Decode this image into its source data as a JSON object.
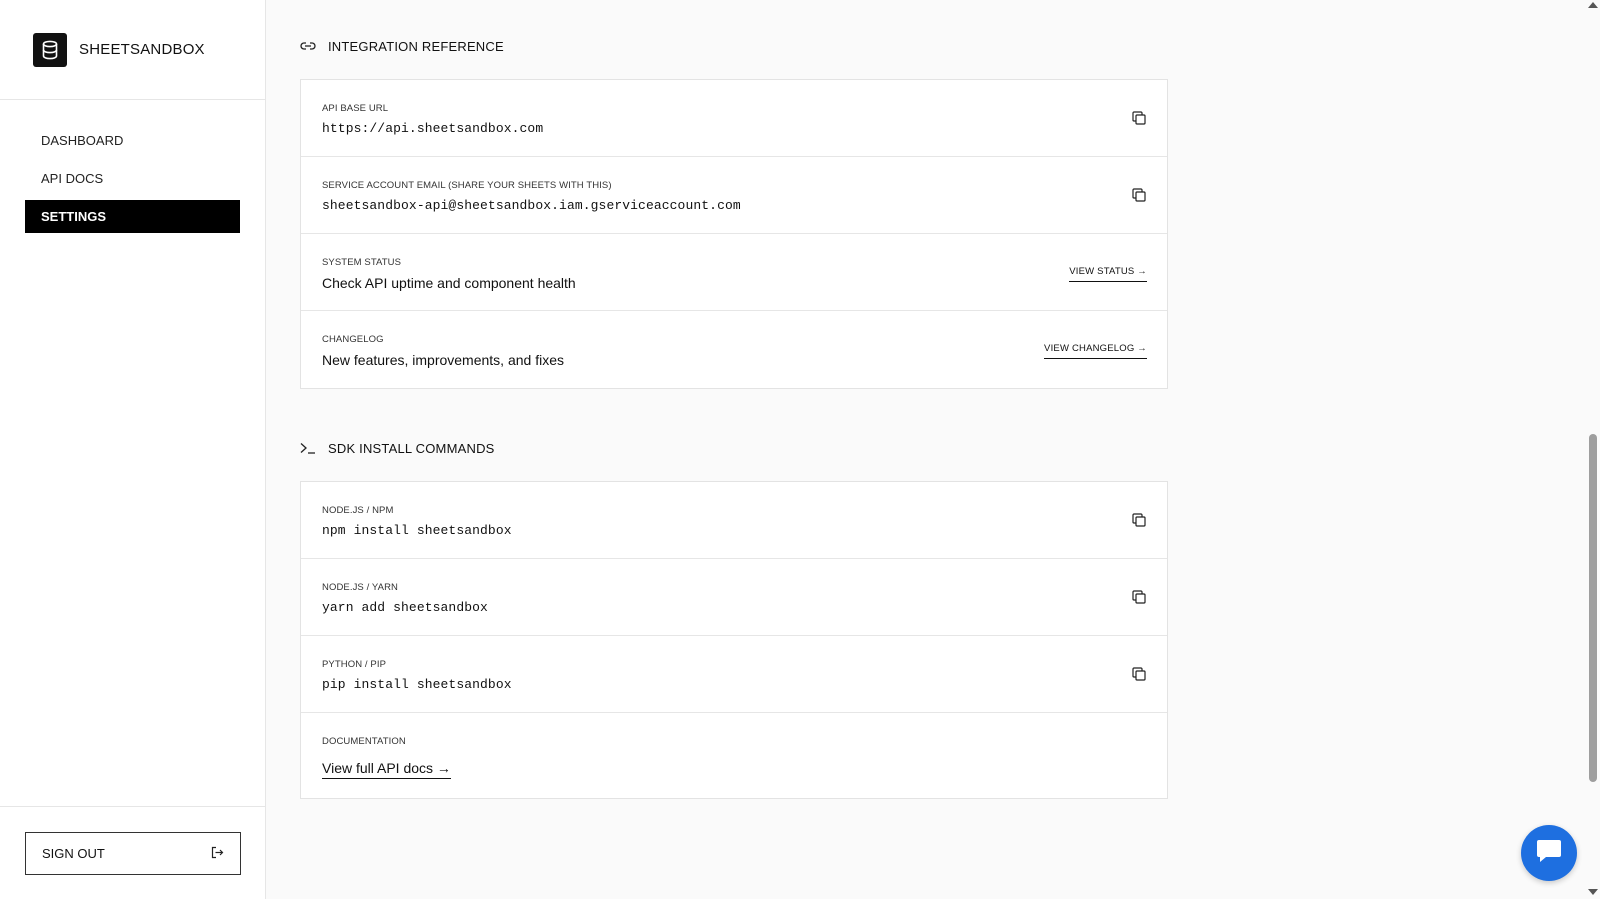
{
  "brand": {
    "name": "SHEETSANDBOX"
  },
  "nav": {
    "items": [
      {
        "label": "DASHBOARD"
      },
      {
        "label": "API DOCS"
      },
      {
        "label": "SETTINGS"
      }
    ]
  },
  "sidebar_bottom": {
    "signout_label": "SIGN OUT"
  },
  "integration": {
    "title": "INTEGRATION REFERENCE",
    "rows": [
      {
        "label": "API BASE URL",
        "value": "https://api.sheetsandbox.com"
      },
      {
        "label": "SERVICE ACCOUNT EMAIL (SHARE YOUR SHEETS WITH THIS)",
        "value": "sheetsandbox-api@sheetsandbox.iam.gserviceaccount.com"
      },
      {
        "label": "SYSTEM STATUS",
        "value": "Check API uptime and component health",
        "link": "VIEW STATUS →"
      },
      {
        "label": "CHANGELOG",
        "value": "New features, improvements, and fixes",
        "link": "VIEW CHANGELOG →"
      }
    ]
  },
  "sdk": {
    "title": "SDK INSTALL COMMANDS",
    "rows": [
      {
        "label": "NODE.JS / NPM",
        "value": "npm install sheetsandbox"
      },
      {
        "label": "NODE.JS / YARN",
        "value": "yarn add sheetsandbox"
      },
      {
        "label": "PYTHON / PIP",
        "value": "pip install sheetsandbox"
      },
      {
        "label": "DOCUMENTATION",
        "link": "View full API docs →"
      }
    ]
  },
  "icons": {
    "brand": "database-icon",
    "integration": "link-icon",
    "sdk": "terminal-icon",
    "copy": "copy-icon",
    "signout": "sign-out-icon",
    "chat": "chat-icon"
  },
  "colors": {
    "active_nav_bg": "#000000",
    "chat_button": "#1e6fe0"
  }
}
